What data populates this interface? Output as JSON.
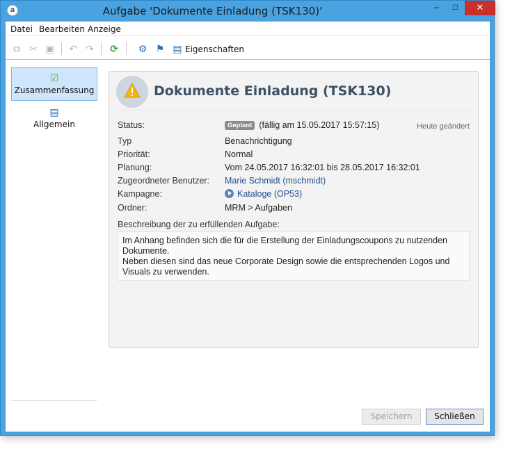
{
  "window": {
    "title": "Aufgabe 'Dokumente Einladung (TSK130)'",
    "controls": {
      "minimize": "–",
      "maximize": "□",
      "close": "✕"
    }
  },
  "menu": [
    "Datei",
    "Bearbeiten",
    "Anzeige"
  ],
  "toolbar": {
    "properties_label": "Eigenschaften",
    "icons": [
      "copy-icon",
      "cut-icon",
      "paste-icon",
      "undo-icon",
      "redo-icon",
      "refresh-icon",
      "settings-icon",
      "assign-icon",
      "properties-icon"
    ]
  },
  "nav": [
    {
      "label": "Zusammenfassung",
      "icon": "checklist-icon",
      "active": true
    },
    {
      "label": "Allgemein",
      "icon": "clipboard-icon",
      "active": false
    }
  ],
  "summary": {
    "title": "Dokumente Einladung (TSK130)",
    "changed": "Heute geändert",
    "status_label": "Status:",
    "status_badge": "Geplant",
    "status_due": "(fällig am 15.05.2017 15:57:15)",
    "fields": [
      {
        "label": "Typ",
        "value": "Benachrichtigung"
      },
      {
        "label": "Priorität:",
        "value": "Normal"
      },
      {
        "label": "Planung:",
        "value": "Vom 24.05.2017 16:32:01 bis 28.05.2017 16:32:01"
      },
      {
        "label": "Zugeordneter Benutzer:",
        "value": "Marie Schmidt (mschmidt)"
      },
      {
        "label": "Kampagne:",
        "value": "Kataloge (OP53)"
      },
      {
        "label": "Ordner:",
        "value": "MRM > Aufgaben"
      }
    ],
    "description_label": "Beschreibung der zu erfüllenden Aufgabe:",
    "description": "Im Anhang befinden sich die für die Erstellung der Einladungscoupons zu nutzenden Dokumente.\nNeben diesen sind das neue Corporate Design sowie die entsprechenden Logos und Visuals zu verwenden."
  },
  "buttons": {
    "save": "Speichern",
    "close": "Schließen"
  },
  "colors": {
    "accent": "#4aa3e0",
    "title_text": "#3c5165",
    "link": "#1f4f8c",
    "badge": "#8a8a8a",
    "close_button": "#c7302b"
  }
}
